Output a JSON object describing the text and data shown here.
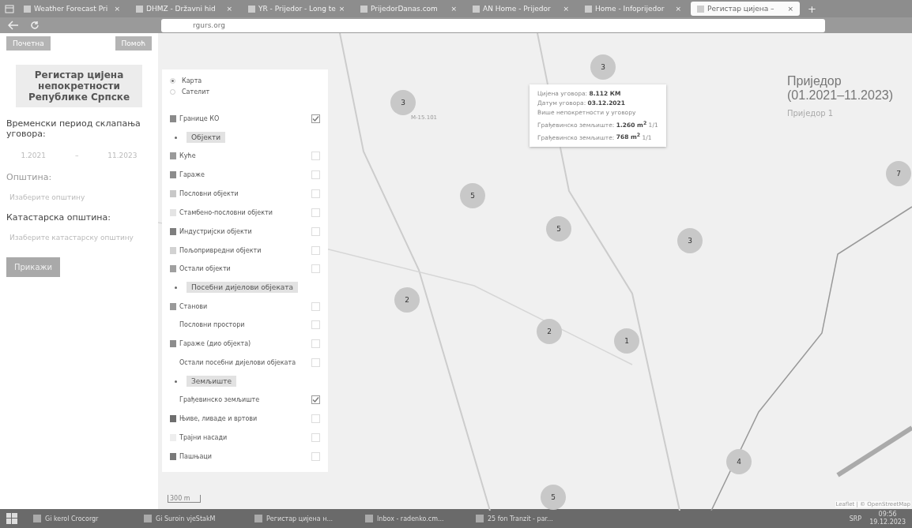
{
  "browser": {
    "tabs": [
      {
        "title": "Weather Forecast Pri",
        "close": "×",
        "selected": false
      },
      {
        "title": "DHMZ - Državni hid",
        "close": "×",
        "selected": false
      },
      {
        "title": "YR - Prijedor - Long te",
        "close": "×",
        "selected": false
      },
      {
        "title": "PrijedorDanas.com",
        "close": "×",
        "selected": false
      },
      {
        "title": "AN Home - Prijedor",
        "close": "×",
        "selected": false
      },
      {
        "title": "Home - Infoprijedor",
        "close": "×",
        "selected": false
      },
      {
        "title": "Регистар цијена –",
        "close": "×",
        "selected": true
      }
    ],
    "new_tab": "+",
    "url": "rgurs.org"
  },
  "sidebar": {
    "buttons": [
      "Почетна",
      "Помоћ"
    ],
    "title": "Регистар цијена непокретности Републике Српске",
    "period_label": "Временски период склапања уговора:",
    "date_from": "1.2021",
    "date_separator": "–",
    "date_to": "11.2023",
    "municipality_label": "Општина:",
    "municipality_placeholder": "Изаберите општину",
    "cadastral_label": "Катастарска општина:",
    "cadastral_placeholder": "Изаберите катастарску општину",
    "show_button": "Прикажи"
  },
  "layers": {
    "base": [
      {
        "label": "Карта",
        "selected": true
      },
      {
        "label": "Сателит",
        "selected": false
      }
    ],
    "items": [
      {
        "kind": "layer",
        "label": "Границе КО",
        "color": "#8a8a8a",
        "checked": true
      },
      {
        "kind": "heading",
        "label": "Објекти"
      },
      {
        "kind": "layer",
        "label": "Куће",
        "color": "#9a9a9a",
        "checked": false
      },
      {
        "kind": "layer",
        "label": "Гараже",
        "color": "#8c8c8c",
        "checked": false
      },
      {
        "kind": "layer",
        "label": "Пословни објекти",
        "color": "#c8c8c8",
        "checked": false
      },
      {
        "kind": "layer",
        "label": "Стамбено-пословни објекти",
        "color": "#e4e4e4",
        "checked": false
      },
      {
        "kind": "layer",
        "label": "Индустријски објекти",
        "color": "#7e7e7e",
        "checked": false
      },
      {
        "kind": "layer",
        "label": "Пољопривредни објекти",
        "color": "#d2d2d2",
        "checked": false
      },
      {
        "kind": "layer",
        "label": "Остали објекти",
        "color": "#a0a0a0",
        "checked": false
      },
      {
        "kind": "heading",
        "label": "Посебни дијелови објеката"
      },
      {
        "kind": "layer",
        "label": "Станови",
        "color": "#9a9a9a",
        "checked": false
      },
      {
        "kind": "layer",
        "label": "Пословни простори",
        "checked": false
      },
      {
        "kind": "layer",
        "label": "Гараже (дио објекта)",
        "color": "#8c8c8c",
        "checked": false
      },
      {
        "kind": "layer",
        "label": "Остали посебни дијелови објеката",
        "checked": false
      },
      {
        "kind": "heading",
        "label": "Земљиште"
      },
      {
        "kind": "layer",
        "label": "Грађевинско земљиште",
        "checked": true
      },
      {
        "kind": "layer",
        "label": "Њиве, ливаде и вртови",
        "color": "#6e6e6e",
        "checked": false
      },
      {
        "kind": "layer",
        "label": "Трајни насади",
        "color": "#eeeeee",
        "checked": false
      },
      {
        "kind": "layer",
        "label": "Пашњаци",
        "color": "#7a7a7a",
        "checked": false
      }
    ]
  },
  "map": {
    "clusters": [
      {
        "label": "3"
      },
      {
        "label": "3"
      },
      {
        "label": "5"
      },
      {
        "label": "5"
      },
      {
        "label": "3"
      },
      {
        "label": "7"
      },
      {
        "label": "2"
      },
      {
        "label": "2"
      },
      {
        "label": "1"
      },
      {
        "label": "4"
      },
      {
        "label": "5"
      }
    ],
    "road_label": "M-15.101",
    "popup": [
      "Цијена уговора: **8.112 КМ**",
      "Датум уговора: **03.12.2021**",
      "Више непокретности у уговору",
      "Грађевинско земљиште: **1.260 m$^{2}$** 1/1",
      "Грађевинско земљиште: **768 m$^{2}$** 1/1"
    ],
    "place_title": "Приједор",
    "place_period": "(01.2021–11.2023)",
    "place_sub": "Приједор 1",
    "scale": "300 m",
    "attribution": "Leaflet | © OpenStreetMap"
  },
  "taskbar": {
    "items": [
      {
        "label": "Gi kerol Crocorgr"
      },
      {
        "label": "Gi Suroin vjeStakM"
      },
      {
        "label": "Регистар цијена н..."
      },
      {
        "label": "Inbox - radenko.cm..."
      },
      {
        "label": "25 fon Tranzit - par..."
      }
    ],
    "language": "SRP",
    "time": "09:56",
    "date": "19.12.2023"
  }
}
